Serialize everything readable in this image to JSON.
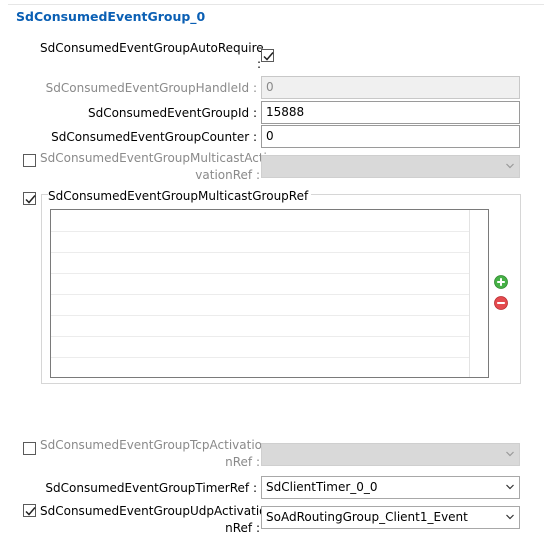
{
  "title": "SdConsumedEventGroup_0",
  "fields": {
    "auto_require": {
      "label_line1": "SdConsumedEventGroupAutoRequire",
      "label_line2": ":",
      "checked": true
    },
    "handle_id": {
      "label": "SdConsumedEventGroupHandleId :",
      "value": "0",
      "enabled": false
    },
    "group_id": {
      "label": "SdConsumedEventGroupId :",
      "value": "15888"
    },
    "counter": {
      "label": "SdConsumedEventGroupCounter :",
      "value": "0"
    },
    "multicast_activation_ref": {
      "label_line1": "SdConsumedEventGroupMulticastActi",
      "label_line2": "vationRef :",
      "value": "",
      "checked": false,
      "enabled": false
    },
    "multicast_group_ref": {
      "label": "SdConsumedEventGroupMulticastGroupRef",
      "checked": true,
      "rows": [
        "",
        "",
        "",
        "",
        "",
        "",
        "",
        ""
      ]
    },
    "tcp_activation_ref": {
      "label_line1": "SdConsumedEventGroupTcpActivatio",
      "label_line2": "nRef :",
      "value": "",
      "checked": false,
      "enabled": false
    },
    "timer_ref": {
      "label": "SdConsumedEventGroupTimerRef :",
      "value": "SdClientTimer_0_0"
    },
    "udp_activation_ref": {
      "label_line1": "SdConsumedEventGroupUdpActivatio",
      "label_line2": "nRef :",
      "value": "SoAdRoutingGroup_Client1_Event",
      "checked": true
    }
  },
  "icons": {
    "add": "add-icon",
    "remove": "remove-icon",
    "dropdown": "chevron-down-icon",
    "check": "check-icon"
  },
  "colors": {
    "title": "#0a5fb4",
    "add": "#3cab3c",
    "remove": "#e0454a"
  }
}
